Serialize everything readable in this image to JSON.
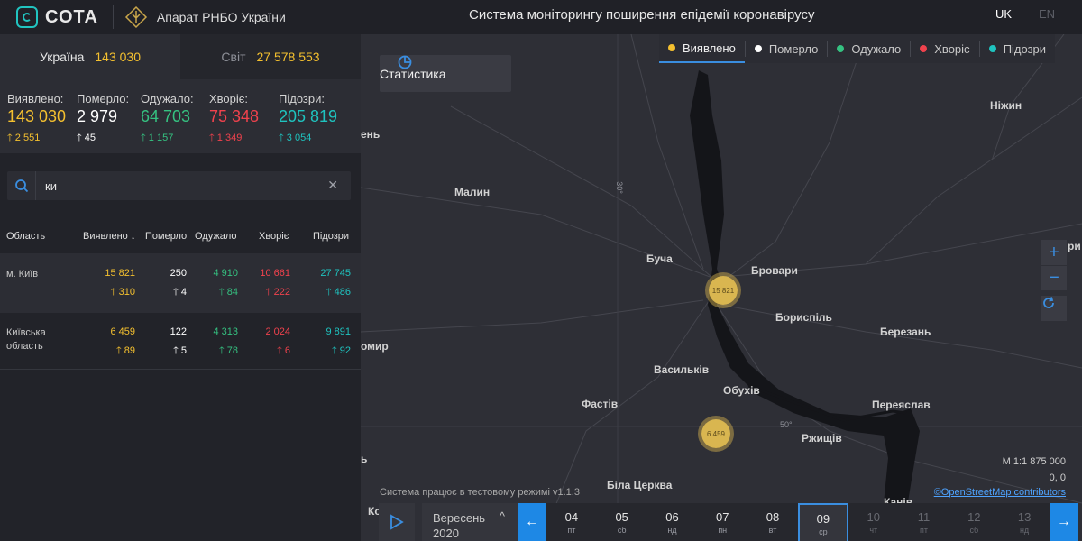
{
  "header": {
    "logo_text": "СОТА",
    "org_name": "Апарат РНБО України",
    "title": "Система моніторингу поширення епідемії коронавірусу",
    "lang_uk": "UK",
    "lang_en": "EN"
  },
  "tabs": {
    "ukraine_label": "Україна",
    "ukraine_value": "143 030",
    "world_label": "Світ",
    "world_value": "27 578 553"
  },
  "stats": [
    {
      "label": "Виявлено:",
      "value": "143 030",
      "delta": "2 551",
      "color": "#f4c02f"
    },
    {
      "label": "Померло:",
      "value": "2 979",
      "delta": "45",
      "color": "#ffffff"
    },
    {
      "label": "Одужало:",
      "value": "64 703",
      "delta": "1 157",
      "color": "#35c281"
    },
    {
      "label": "Хворіє:",
      "value": "75 348",
      "delta": "1 349",
      "color": "#f0424d"
    },
    {
      "label": "Підозри:",
      "value": "205 819",
      "delta": "3 054",
      "color": "#1fc3bf"
    }
  ],
  "search": {
    "value": "ки",
    "placeholder": ""
  },
  "table": {
    "headers": {
      "region": "Область",
      "detected": "Виявлено",
      "dead": "Померло",
      "recovered": "Одужало",
      "sick": "Хворіє",
      "suspected": "Підозри"
    },
    "rows": [
      {
        "name": "м. Київ",
        "detected": "15 821",
        "detected_d": "310",
        "dead": "250",
        "dead_d": "4",
        "recovered": "4 910",
        "recovered_d": "84",
        "sick": "10 661",
        "sick_d": "222",
        "suspected": "27 745",
        "suspected_d": "486"
      },
      {
        "name": "Київська область",
        "detected": "6 459",
        "detected_d": "89",
        "dead": "122",
        "dead_d": "5",
        "recovered": "4 313",
        "recovered_d": "78",
        "sick": "2 024",
        "sick_d": "6",
        "suspected": "9 891",
        "suspected_d": "92"
      }
    ]
  },
  "map": {
    "stat_button": "Статистика",
    "legend": [
      {
        "label": "Виявлено",
        "color": "#f4c02f"
      },
      {
        "label": "Померло",
        "color": "#ffffff"
      },
      {
        "label": "Одужало",
        "color": "#35c281"
      },
      {
        "label": "Хворіє",
        "color": "#f0424d"
      },
      {
        "label": "Підозри",
        "color": "#1fc3bf"
      }
    ],
    "places": {
      "nizhyn": "Ніжин",
      "malyn": "Малин",
      "bucha": "Буча",
      "brovary": "Бровари",
      "boryspil": "Бориспіль",
      "berezan": "Березань",
      "vasylkiv": "Васильків",
      "obukhiv": "Обухів",
      "fastiv": "Фастів",
      "pereiaslav": "Переяслав",
      "rzhyshchiv": "Ржищів",
      "bila_tserkva": "Біла Церква",
      "kaniv": "Канів",
      "edge_left1": "ень",
      "edge_left2": "омир",
      "edge_left3": "ь",
      "edge_left4": "Ко",
      "edge_right": "ри"
    },
    "graticule": {
      "lon": "30°",
      "lat": "50°"
    },
    "clusters": [
      {
        "label": "15 821"
      },
      {
        "label": "6 459"
      }
    ],
    "scale": "M 1:1 875 000",
    "coords": "0, 0",
    "attribution": "©OpenStreetMap contributors",
    "test_mode": "Система працює в тестовому режимі v1.1.3"
  },
  "timeline": {
    "month": "Вересень",
    "year": "2020",
    "days": [
      {
        "n": "04",
        "w": "пт"
      },
      {
        "n": "05",
        "w": "сб"
      },
      {
        "n": "06",
        "w": "нд"
      },
      {
        "n": "07",
        "w": "пн"
      },
      {
        "n": "08",
        "w": "вт"
      },
      {
        "n": "09",
        "w": "ср"
      },
      {
        "n": "10",
        "w": "чт"
      },
      {
        "n": "11",
        "w": "пт"
      },
      {
        "n": "12",
        "w": "сб"
      },
      {
        "n": "13",
        "w": "нд"
      }
    ]
  }
}
